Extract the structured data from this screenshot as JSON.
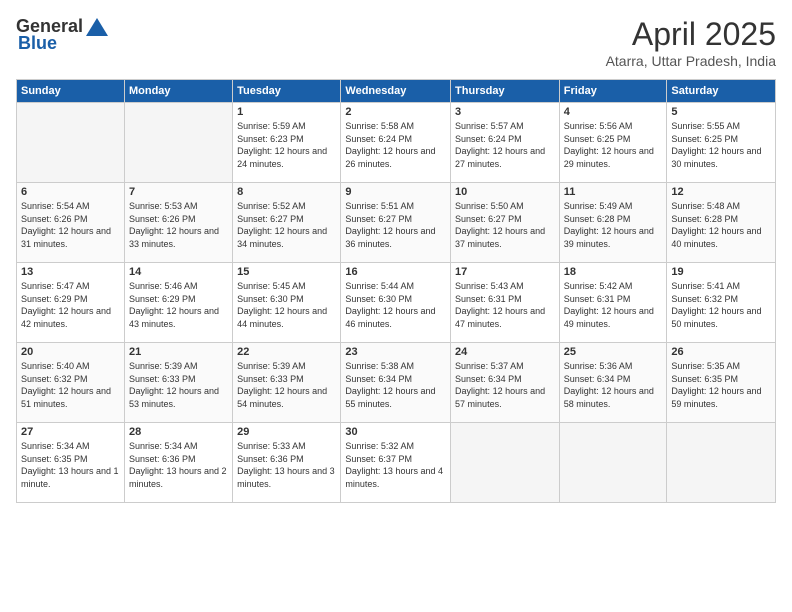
{
  "header": {
    "logo_general": "General",
    "logo_blue": "Blue",
    "month_title": "April 2025",
    "location": "Atarra, Uttar Pradesh, India"
  },
  "days_of_week": [
    "Sunday",
    "Monday",
    "Tuesday",
    "Wednesday",
    "Thursday",
    "Friday",
    "Saturday"
  ],
  "weeks": [
    [
      {
        "day": "",
        "info": ""
      },
      {
        "day": "",
        "info": ""
      },
      {
        "day": "1",
        "info": "Sunrise: 5:59 AM\nSunset: 6:23 PM\nDaylight: 12 hours and 24 minutes."
      },
      {
        "day": "2",
        "info": "Sunrise: 5:58 AM\nSunset: 6:24 PM\nDaylight: 12 hours and 26 minutes."
      },
      {
        "day": "3",
        "info": "Sunrise: 5:57 AM\nSunset: 6:24 PM\nDaylight: 12 hours and 27 minutes."
      },
      {
        "day": "4",
        "info": "Sunrise: 5:56 AM\nSunset: 6:25 PM\nDaylight: 12 hours and 29 minutes."
      },
      {
        "day": "5",
        "info": "Sunrise: 5:55 AM\nSunset: 6:25 PM\nDaylight: 12 hours and 30 minutes."
      }
    ],
    [
      {
        "day": "6",
        "info": "Sunrise: 5:54 AM\nSunset: 6:26 PM\nDaylight: 12 hours and 31 minutes."
      },
      {
        "day": "7",
        "info": "Sunrise: 5:53 AM\nSunset: 6:26 PM\nDaylight: 12 hours and 33 minutes."
      },
      {
        "day": "8",
        "info": "Sunrise: 5:52 AM\nSunset: 6:27 PM\nDaylight: 12 hours and 34 minutes."
      },
      {
        "day": "9",
        "info": "Sunrise: 5:51 AM\nSunset: 6:27 PM\nDaylight: 12 hours and 36 minutes."
      },
      {
        "day": "10",
        "info": "Sunrise: 5:50 AM\nSunset: 6:27 PM\nDaylight: 12 hours and 37 minutes."
      },
      {
        "day": "11",
        "info": "Sunrise: 5:49 AM\nSunset: 6:28 PM\nDaylight: 12 hours and 39 minutes."
      },
      {
        "day": "12",
        "info": "Sunrise: 5:48 AM\nSunset: 6:28 PM\nDaylight: 12 hours and 40 minutes."
      }
    ],
    [
      {
        "day": "13",
        "info": "Sunrise: 5:47 AM\nSunset: 6:29 PM\nDaylight: 12 hours and 42 minutes."
      },
      {
        "day": "14",
        "info": "Sunrise: 5:46 AM\nSunset: 6:29 PM\nDaylight: 12 hours and 43 minutes."
      },
      {
        "day": "15",
        "info": "Sunrise: 5:45 AM\nSunset: 6:30 PM\nDaylight: 12 hours and 44 minutes."
      },
      {
        "day": "16",
        "info": "Sunrise: 5:44 AM\nSunset: 6:30 PM\nDaylight: 12 hours and 46 minutes."
      },
      {
        "day": "17",
        "info": "Sunrise: 5:43 AM\nSunset: 6:31 PM\nDaylight: 12 hours and 47 minutes."
      },
      {
        "day": "18",
        "info": "Sunrise: 5:42 AM\nSunset: 6:31 PM\nDaylight: 12 hours and 49 minutes."
      },
      {
        "day": "19",
        "info": "Sunrise: 5:41 AM\nSunset: 6:32 PM\nDaylight: 12 hours and 50 minutes."
      }
    ],
    [
      {
        "day": "20",
        "info": "Sunrise: 5:40 AM\nSunset: 6:32 PM\nDaylight: 12 hours and 51 minutes."
      },
      {
        "day": "21",
        "info": "Sunrise: 5:39 AM\nSunset: 6:33 PM\nDaylight: 12 hours and 53 minutes."
      },
      {
        "day": "22",
        "info": "Sunrise: 5:39 AM\nSunset: 6:33 PM\nDaylight: 12 hours and 54 minutes."
      },
      {
        "day": "23",
        "info": "Sunrise: 5:38 AM\nSunset: 6:34 PM\nDaylight: 12 hours and 55 minutes."
      },
      {
        "day": "24",
        "info": "Sunrise: 5:37 AM\nSunset: 6:34 PM\nDaylight: 12 hours and 57 minutes."
      },
      {
        "day": "25",
        "info": "Sunrise: 5:36 AM\nSunset: 6:34 PM\nDaylight: 12 hours and 58 minutes."
      },
      {
        "day": "26",
        "info": "Sunrise: 5:35 AM\nSunset: 6:35 PM\nDaylight: 12 hours and 59 minutes."
      }
    ],
    [
      {
        "day": "27",
        "info": "Sunrise: 5:34 AM\nSunset: 6:35 PM\nDaylight: 13 hours and 1 minute."
      },
      {
        "day": "28",
        "info": "Sunrise: 5:34 AM\nSunset: 6:36 PM\nDaylight: 13 hours and 2 minutes."
      },
      {
        "day": "29",
        "info": "Sunrise: 5:33 AM\nSunset: 6:36 PM\nDaylight: 13 hours and 3 minutes."
      },
      {
        "day": "30",
        "info": "Sunrise: 5:32 AM\nSunset: 6:37 PM\nDaylight: 13 hours and 4 minutes."
      },
      {
        "day": "",
        "info": ""
      },
      {
        "day": "",
        "info": ""
      },
      {
        "day": "",
        "info": ""
      }
    ]
  ]
}
